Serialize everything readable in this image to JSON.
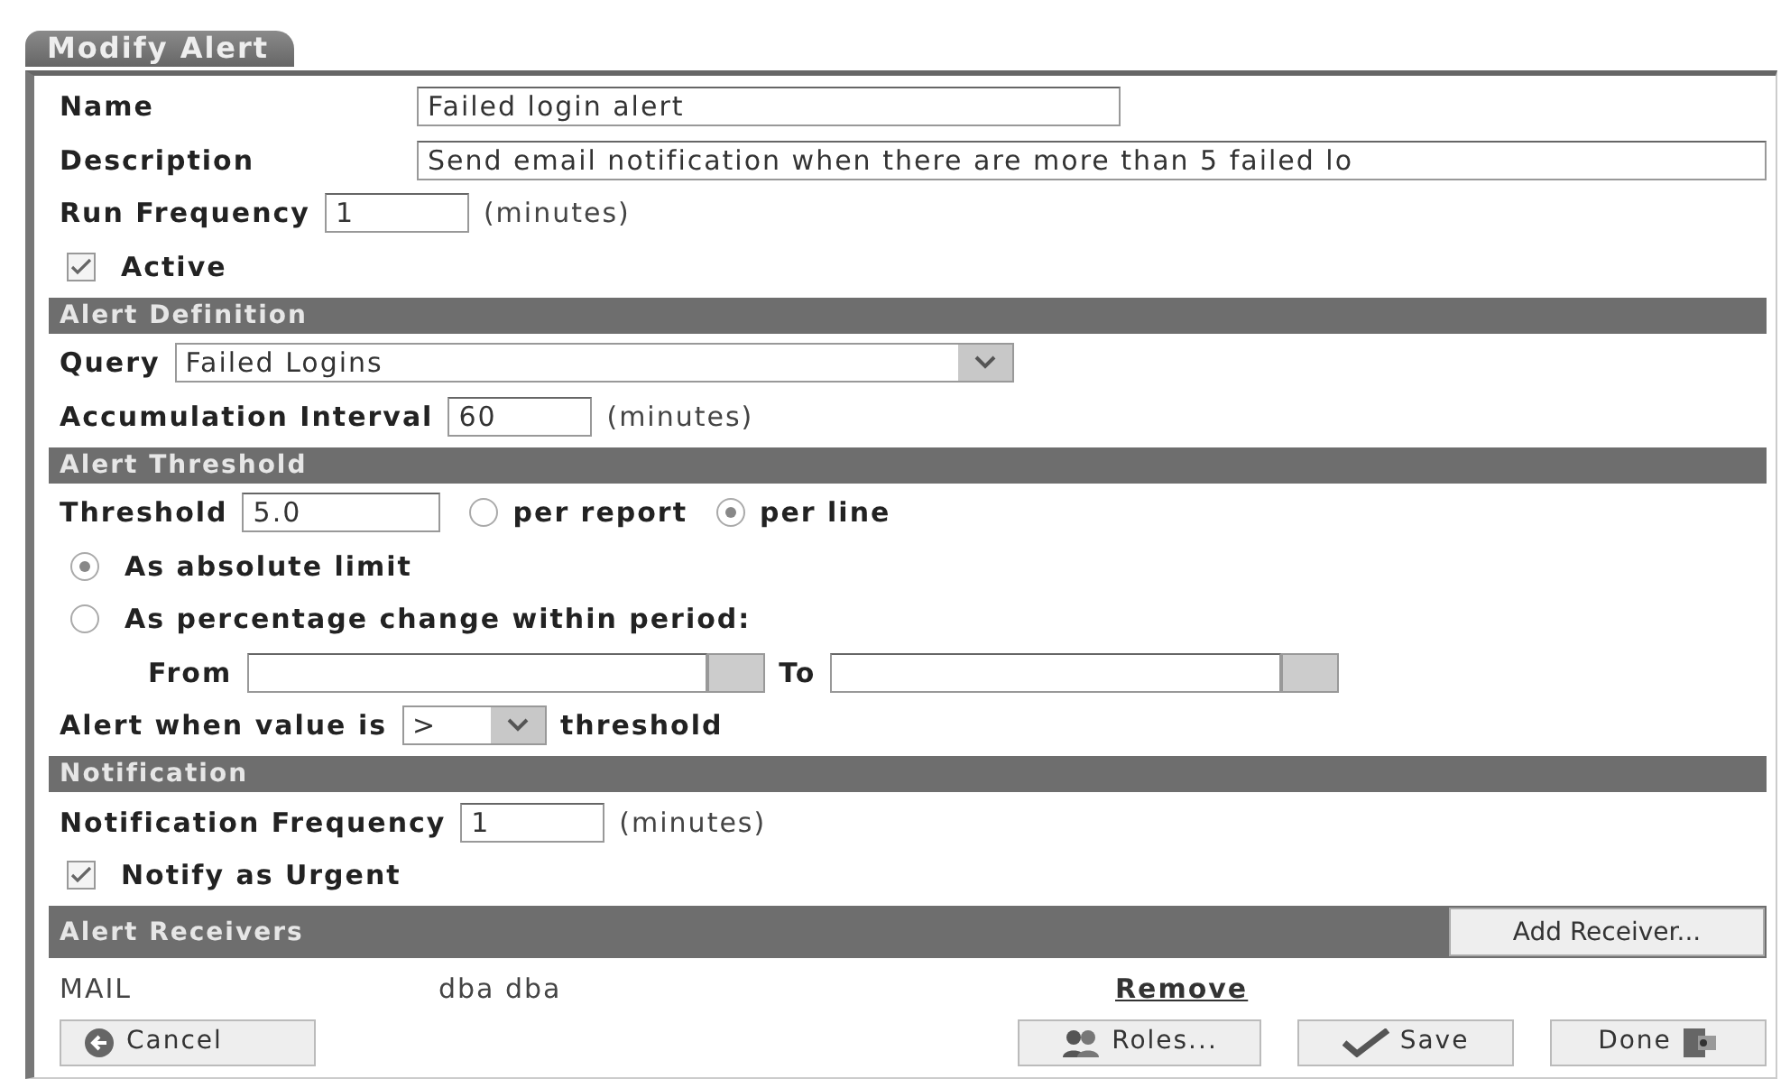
{
  "title": "Modify Alert",
  "sections": [
    {
      "rows": [
        {
          "kind": "medium-field",
          "label": "Name",
          "value": "Failed login alert"
        },
        {
          "kind": "wide-field",
          "label": "Description",
          "value": "Send email notification when there are more than 5 failed lo"
        },
        {
          "kind": "short-field",
          "label": "Run Frequency",
          "value": "1",
          "unit": "(minutes)"
        },
        {
          "kind": "checkbox",
          "label": "Active",
          "checked": true
        }
      ]
    },
    {
      "heading": "Alert Definition",
      "rows": [
        {
          "kind": "select",
          "label": "Query",
          "value": "Failed Logins"
        },
        {
          "kind": "short-field",
          "label": "Accumulation Interval",
          "value": "60",
          "unit": "(minutes)"
        }
      ]
    },
    {
      "heading": "Alert Threshold",
      "rows": [
        {
          "kind": "field-radios",
          "label": "Threshold",
          "value": "5.0",
          "options": [
            {
              "label": "per report",
              "selected": false
            },
            {
              "label": "per line",
              "selected": true
            }
          ]
        },
        {
          "kind": "radio",
          "label": "As absolute limit",
          "selected": true
        },
        {
          "kind": "radio",
          "label": "As percentage change within period:",
          "selected": false
        },
        {
          "kind": "date-range",
          "from_label": "From",
          "to_label": "To"
        },
        {
          "kind": "compare",
          "label": "Alert when value is",
          "value": ">",
          "unit": "threshold"
        }
      ]
    },
    {
      "heading": "Notification",
      "rows": [
        {
          "kind": "short-field",
          "label": "Notification Frequency",
          "value": "1",
          "unit": "(minutes)"
        },
        {
          "kind": "checkbox",
          "label": "Notify as Urgent",
          "checked": true
        }
      ]
    },
    {
      "heading": "Alert Receivers",
      "button": "Add Receiver...",
      "receivers": [
        {
          "type": "MAIL",
          "name": "dba dba",
          "action": "Remove"
        }
      ]
    }
  ],
  "buttons": [
    {
      "kind": "cancel",
      "label": "Cancel"
    },
    {
      "kind": "roles",
      "label": "Roles..."
    },
    {
      "kind": "save",
      "label": "Save"
    },
    {
      "kind": "done",
      "label": "Done"
    }
  ]
}
